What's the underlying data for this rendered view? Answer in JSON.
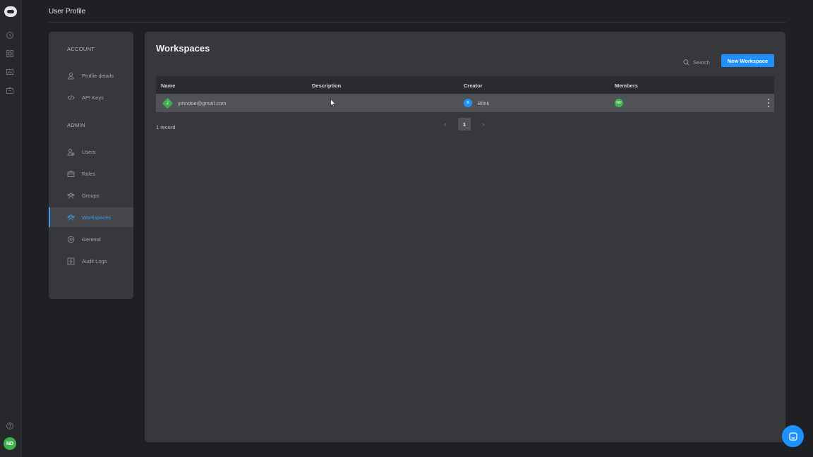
{
  "header": {
    "title": "User Profile"
  },
  "rail": {
    "avatar_initials": "ND",
    "avatar_color": "#3fb04d"
  },
  "sidebar": {
    "sections": [
      {
        "label": "ACCOUNT"
      },
      {
        "label": "ADMIN"
      }
    ],
    "items": [
      {
        "label": "Profile details",
        "icon": "user-icon"
      },
      {
        "label": "API Keys",
        "icon": "code-icon"
      },
      {
        "label": "Users",
        "icon": "users-icon"
      },
      {
        "label": "Roles",
        "icon": "briefcase-icon"
      },
      {
        "label": "Groups",
        "icon": "group-icon"
      },
      {
        "label": "Workspaces",
        "icon": "workspaces-icon",
        "active": true
      },
      {
        "label": "General",
        "icon": "settings-icon"
      },
      {
        "label": "Audit Logs",
        "icon": "activity-icon"
      }
    ]
  },
  "main": {
    "title": "Workspaces",
    "search_label": "Search",
    "new_button_label": "New Workspace",
    "columns": [
      "Name",
      "Description",
      "Creator",
      "Members"
    ],
    "rows": [
      {
        "name": "johndoe@gmail.com",
        "name_initial": "J",
        "description": "",
        "creator": "Blink",
        "creator_initial": "B",
        "member_initials": "ND"
      }
    ],
    "record_count": "1 record",
    "pagination": {
      "current_page": "1",
      "prev": "‹",
      "next": "›"
    }
  },
  "colors": {
    "accent": "#1e90ff",
    "green": "#3fb04d",
    "panel": "#37383b",
    "background": "#1f2023"
  }
}
